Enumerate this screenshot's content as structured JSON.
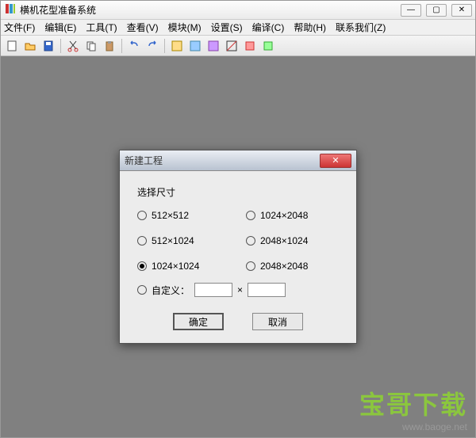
{
  "app": {
    "title": "横机花型准备系统"
  },
  "menu": [
    "文件(F)",
    "编辑(E)",
    "工具(T)",
    "查看(V)",
    "模块(M)",
    "设置(S)",
    "编译(C)",
    "帮助(H)",
    "联系我们(Z)"
  ],
  "dialog": {
    "title": "新建工程",
    "group_label": "选择尺寸",
    "options": [
      {
        "label": "512×512",
        "checked": false
      },
      {
        "label": "1024×2048",
        "checked": false
      },
      {
        "label": "512×1024",
        "checked": false
      },
      {
        "label": "2048×1024",
        "checked": false
      },
      {
        "label": "1024×1024",
        "checked": true
      },
      {
        "label": "2048×2048",
        "checked": false
      }
    ],
    "custom_label": "自定义：",
    "custom_sep": "×",
    "custom_w": "",
    "custom_h": "",
    "ok": "确定",
    "cancel": "取消"
  },
  "watermark": {
    "text": "宝哥下载",
    "url": "www.baoge.net"
  }
}
